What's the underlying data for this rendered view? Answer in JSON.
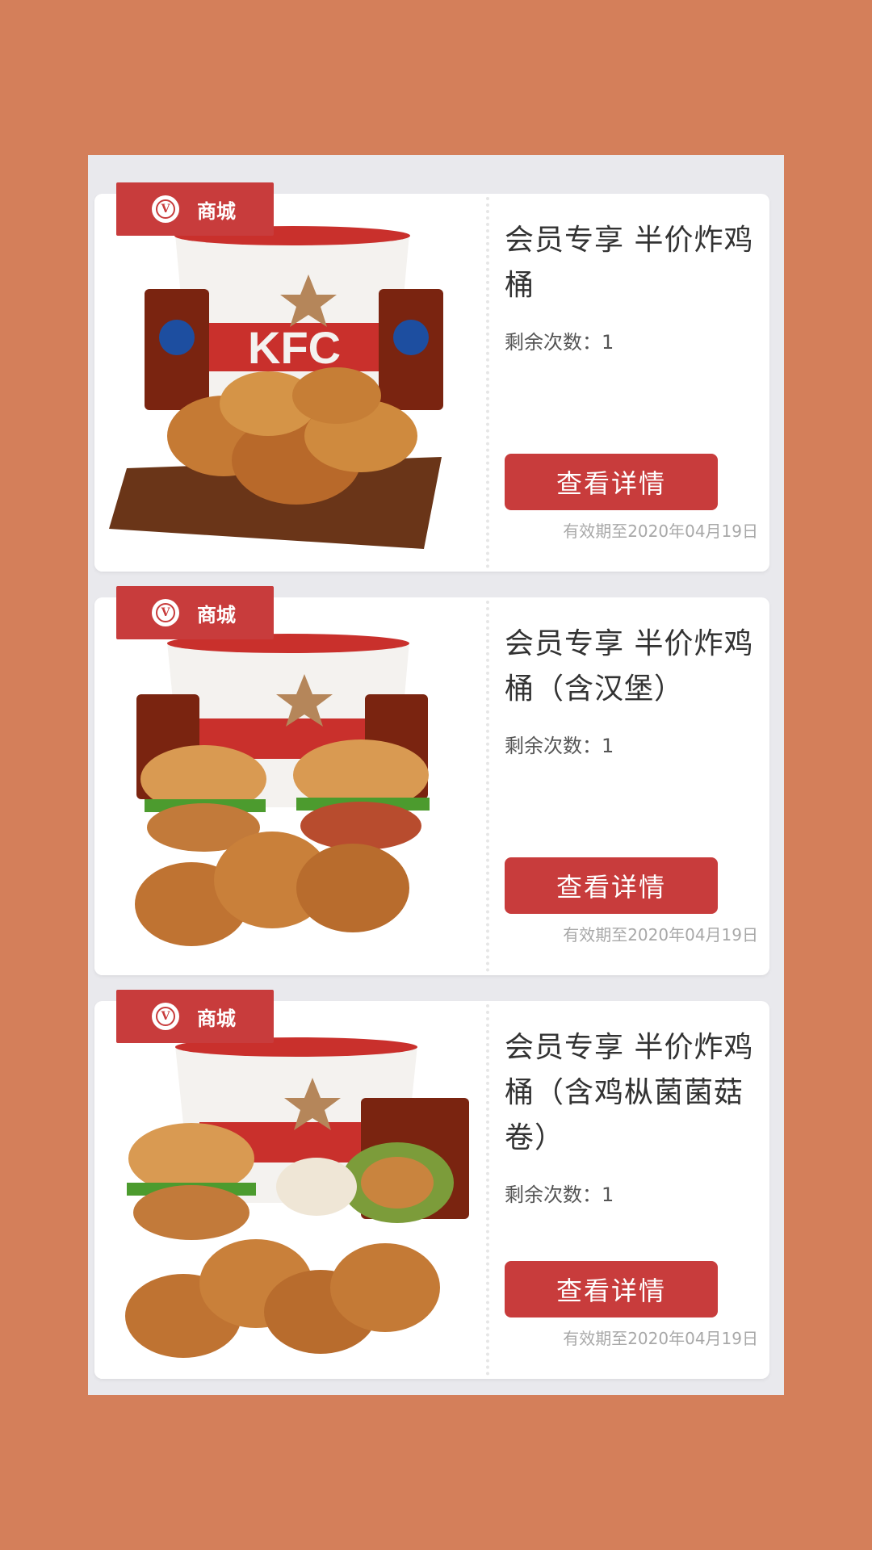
{
  "coupons": [
    {
      "tag": "商城",
      "title": "会员专享 半价炸鸡桶",
      "remain_label": "剩余次数：1",
      "button_label": "查看详情",
      "expire": "有效期至2020年04月19日",
      "image": "fried-chicken-bucket-with-two-pepsi"
    },
    {
      "tag": "商城",
      "title": "会员专享 半价炸鸡桶（含汉堡）",
      "remain_label": "剩余次数：1",
      "button_label": "查看详情",
      "expire": "有效期至2020年04月19日",
      "image": "bucket-with-two-burgers-and-drumsticks"
    },
    {
      "tag": "商城",
      "title": "会员专享 半价炸鸡桶（含鸡枞菌菌菇卷）",
      "remain_label": "剩余次数：1",
      "button_label": "查看详情",
      "expire": "有效期至2020年04月19日",
      "image": "bucket-with-burger-wrap-and-drumsticks"
    }
  ],
  "colors": {
    "background": "#d47f5a",
    "accent": "#c83c3c",
    "card": "#ffffff",
    "panel": "#e9e9ed"
  },
  "icons": {
    "tag_icon": "v-badge-icon",
    "tag_icon_letter": "V"
  }
}
